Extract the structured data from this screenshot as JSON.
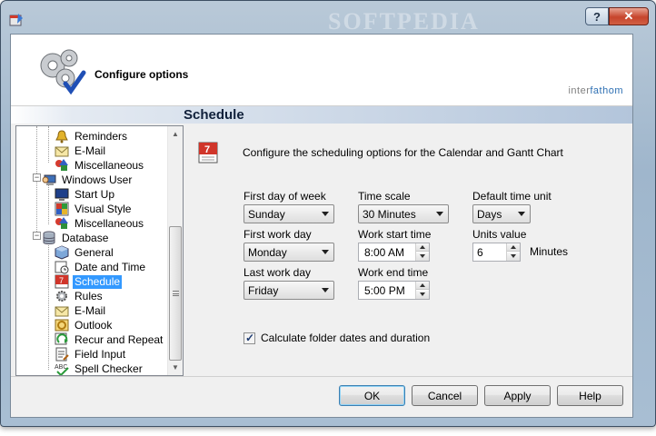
{
  "window": {
    "watermark": "SOFTPEDIA",
    "help_glyph": "?",
    "close_glyph": "✕"
  },
  "header": {
    "title": "Configure options",
    "brand_part1": "inter",
    "brand_part2": "fathom"
  },
  "section": {
    "title": "Schedule"
  },
  "tree": {
    "items": [
      {
        "label": "Reminders",
        "icon": "bell-icon"
      },
      {
        "label": "E-Mail",
        "icon": "envelope-icon"
      },
      {
        "label": "Miscellaneous",
        "icon": "shapes-icon"
      },
      {
        "label": "Windows User",
        "icon": "user-computer-icon"
      },
      {
        "label": "Start Up",
        "icon": "monitor-icon"
      },
      {
        "label": "Visual Style",
        "icon": "palette-icon"
      },
      {
        "label": "Miscellaneous",
        "icon": "shapes-icon"
      },
      {
        "label": "Database",
        "icon": "database-icon"
      },
      {
        "label": "General",
        "icon": "cube-icon"
      },
      {
        "label": "Date and Time",
        "icon": "clock-icon"
      },
      {
        "label": "Schedule",
        "icon": "calendar-icon",
        "selected": true
      },
      {
        "label": "Rules",
        "icon": "gear-icon"
      },
      {
        "label": "E-Mail",
        "icon": "envelope-icon"
      },
      {
        "label": "Outlook",
        "icon": "outlook-icon"
      },
      {
        "label": "Recur and Repeat",
        "icon": "recur-icon"
      },
      {
        "label": "Field Input",
        "icon": "form-icon"
      },
      {
        "label": "Spell Checker",
        "icon": "spellcheck-icon"
      }
    ]
  },
  "schedule": {
    "description": "Configure the scheduling options for the Calendar and Gantt Chart",
    "first_day_label": "First day of week",
    "first_day_value": "Sunday",
    "time_scale_label": "Time scale",
    "time_scale_value": "30 Minutes",
    "default_unit_label": "Default time unit",
    "default_unit_value": "Days",
    "first_work_day_label": "First work day",
    "first_work_day_value": "Monday",
    "work_start_label": "Work start time",
    "work_start_value": "8:00 AM",
    "units_value_label": "Units value",
    "units_value": "6",
    "units_suffix": "Minutes",
    "last_work_day_label": "Last work day",
    "last_work_day_value": "Friday",
    "work_end_label": "Work end time",
    "work_end_value": "5:00 PM",
    "calc_label": "Calculate folder dates and duration",
    "calc_checked": true
  },
  "buttons": {
    "ok": "OK",
    "cancel": "Cancel",
    "apply": "Apply",
    "help": "Help"
  },
  "colors": {
    "selection": "#3399ff",
    "section_bar": "#b3c5db",
    "brand_blue": "#2d6fb3"
  }
}
